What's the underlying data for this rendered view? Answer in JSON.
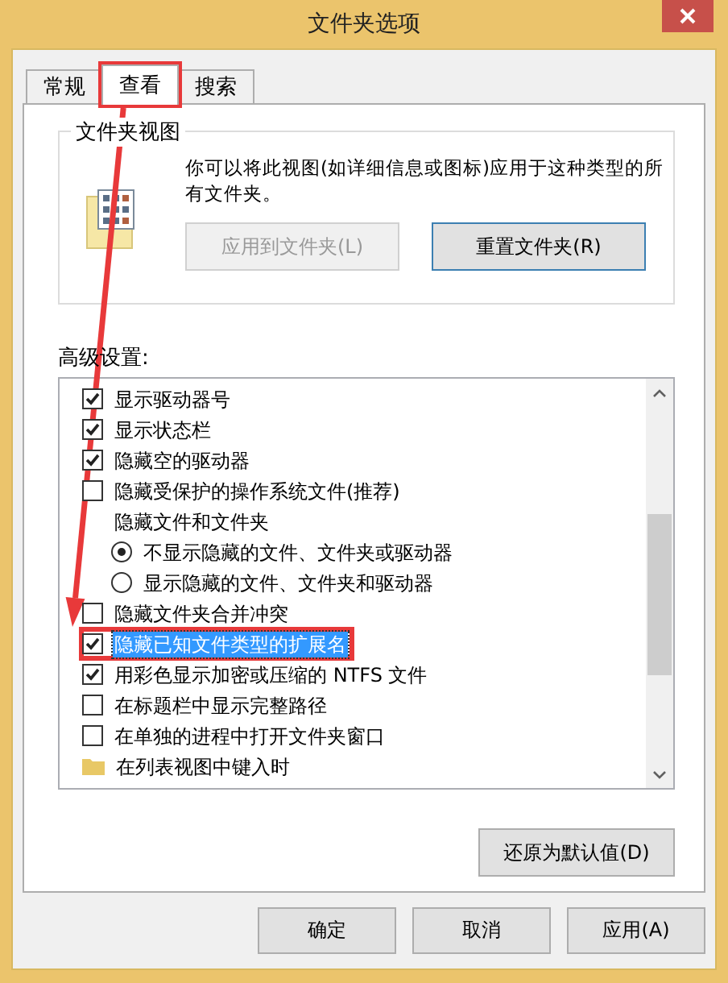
{
  "window": {
    "title": "文件夹选项"
  },
  "tabs": [
    {
      "label": "常规",
      "selected": false,
      "annotated": false
    },
    {
      "label": "查看",
      "selected": true,
      "annotated": true
    },
    {
      "label": "搜索",
      "selected": false,
      "annotated": false
    }
  ],
  "folder_views": {
    "title": "文件夹视图",
    "description": "你可以将此视图(如详细信息或图标)应用于这种类型的所有文件夹。",
    "buttons": [
      {
        "label": "应用到文件夹(L)",
        "disabled": true,
        "focused": false
      },
      {
        "label": "重置文件夹(R)",
        "disabled": false,
        "focused": true
      }
    ]
  },
  "advanced": {
    "label": "高级设置:",
    "items": [
      {
        "kind": "checkbox",
        "label": "显示驱动器号",
        "checked": true,
        "selected": false,
        "annotated": false
      },
      {
        "kind": "checkbox",
        "label": "显示状态栏",
        "checked": true,
        "selected": false,
        "annotated": false
      },
      {
        "kind": "checkbox",
        "label": "隐藏空的驱动器",
        "checked": true,
        "selected": false,
        "annotated": false
      },
      {
        "kind": "checkbox",
        "label": "隐藏受保护的操作系统文件(推荐)",
        "checked": false,
        "selected": false,
        "annotated": false
      },
      {
        "kind": "group",
        "label": "隐藏文件和文件夹",
        "selected": false,
        "annotated": false,
        "children": [
          {
            "kind": "radio",
            "label": "不显示隐藏的文件、文件夹或驱动器",
            "checked": true,
            "selected": false,
            "annotated": false
          },
          {
            "kind": "radio",
            "label": "显示隐藏的文件、文件夹和驱动器",
            "checked": false,
            "selected": false,
            "annotated": false
          }
        ]
      },
      {
        "kind": "checkbox",
        "label": "隐藏文件夹合并冲突",
        "checked": false,
        "selected": false,
        "annotated": false
      },
      {
        "kind": "checkbox",
        "label": "隐藏已知文件类型的扩展名",
        "checked": true,
        "selected": true,
        "annotated": true
      },
      {
        "kind": "checkbox",
        "label": "用彩色显示加密或压缩的 NTFS 文件",
        "checked": true,
        "selected": false,
        "annotated": false
      },
      {
        "kind": "checkbox",
        "label": "在标题栏中显示完整路径",
        "checked": false,
        "selected": false,
        "annotated": false
      },
      {
        "kind": "checkbox",
        "label": "在单独的进程中打开文件夹窗口",
        "checked": false,
        "selected": false,
        "annotated": false
      },
      {
        "kind": "folder",
        "label": "在列表视图中键入时",
        "selected": false,
        "annotated": false
      }
    ]
  },
  "restore_button": "还原为默认值(D)",
  "dialog_buttons": [
    "确定",
    "取消",
    "应用(A)"
  ]
}
